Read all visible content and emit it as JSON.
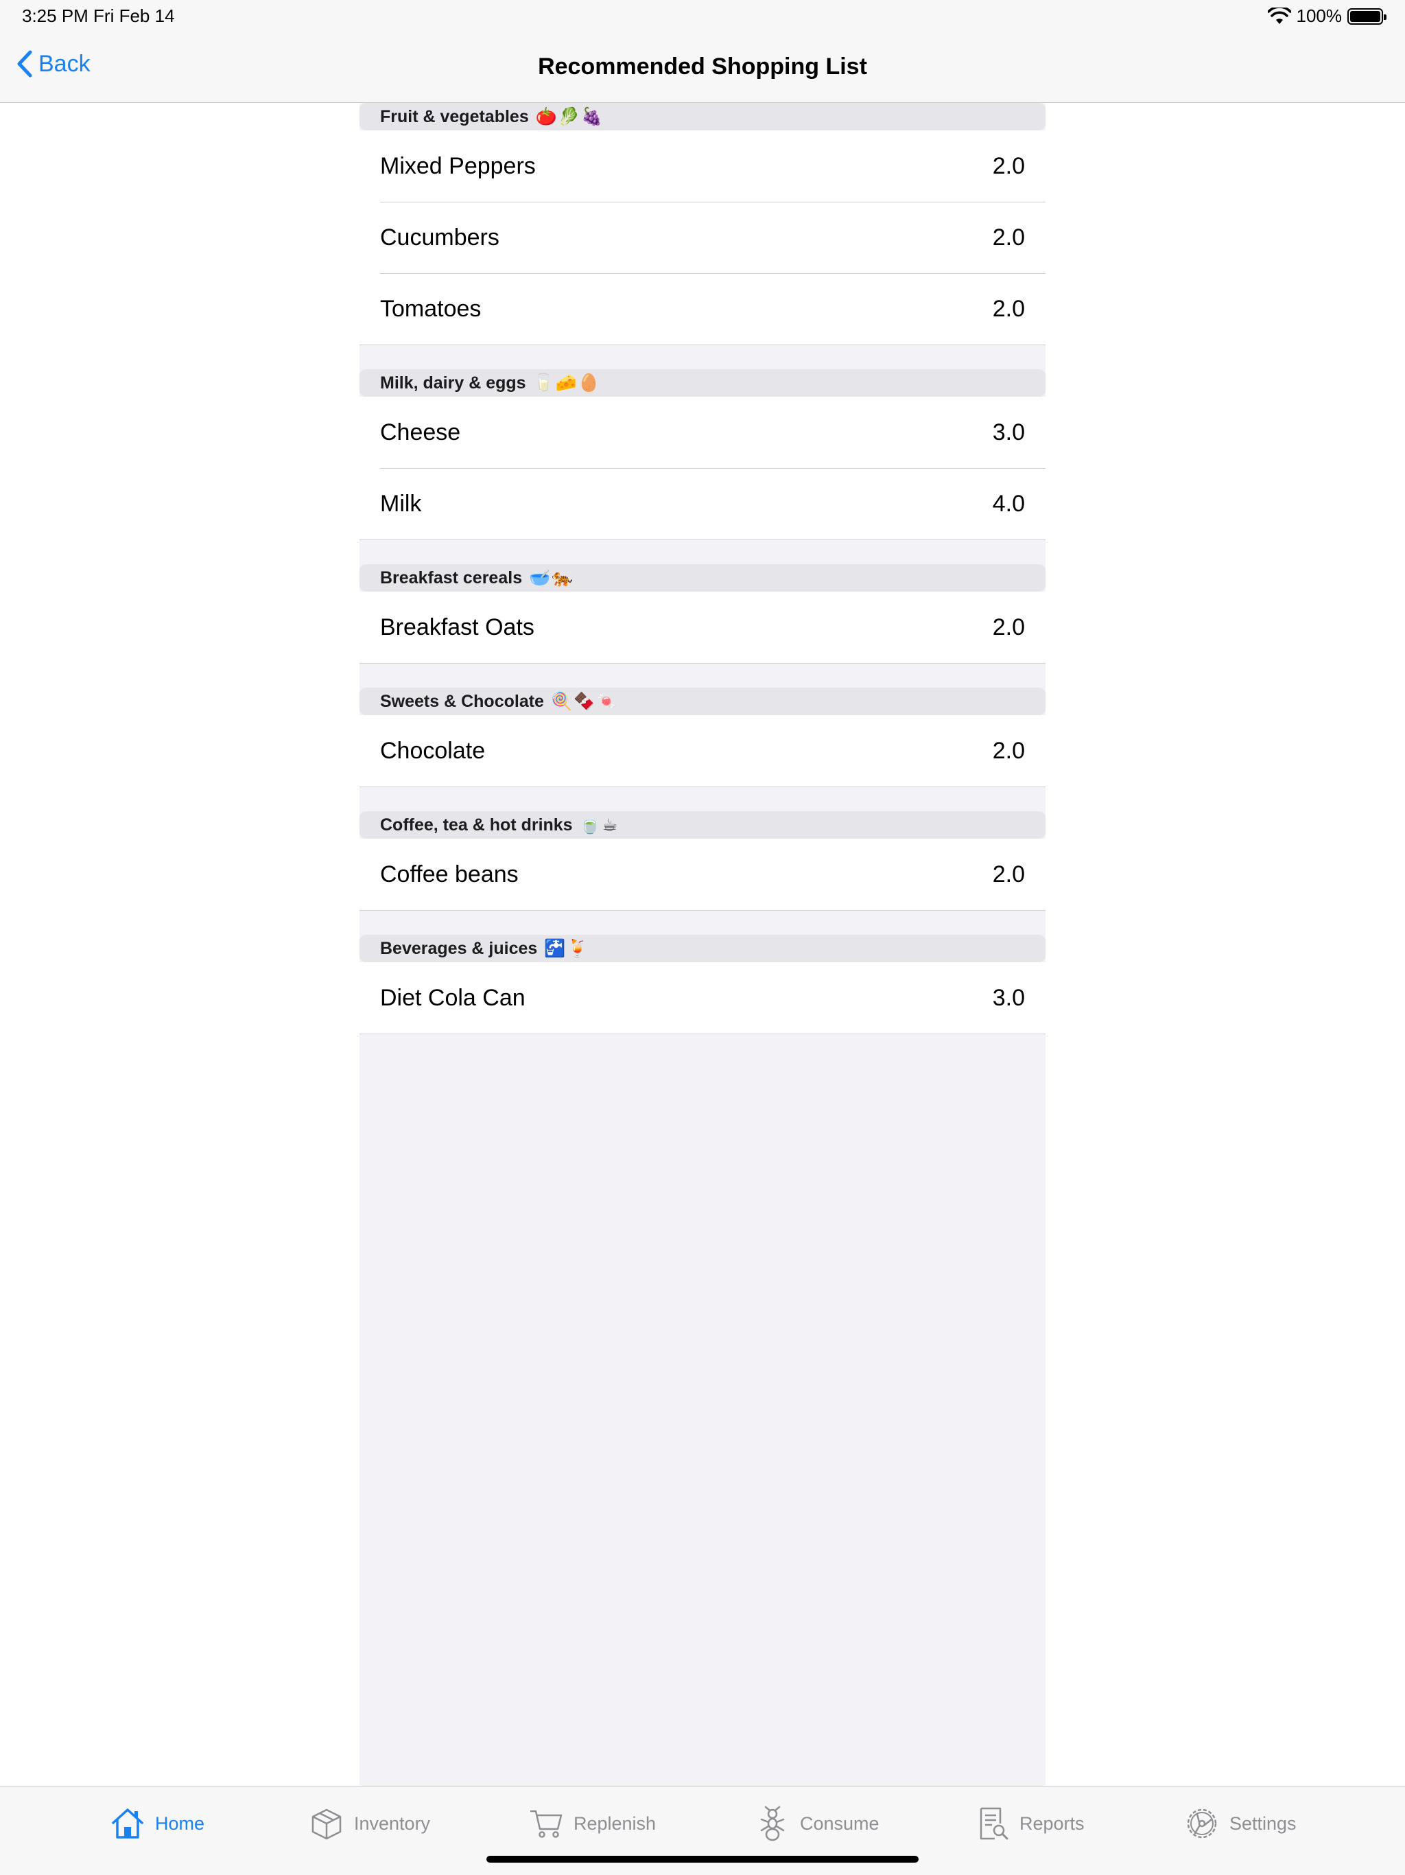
{
  "status_bar": {
    "time": "3:25 PM   Fri Feb 14",
    "battery": "100%"
  },
  "nav": {
    "back_label": "Back",
    "title": "Recommended Shopping List"
  },
  "sections": [
    {
      "header": "Fruit & vegetables",
      "emoji": "🍅🥬🍇",
      "items": [
        {
          "name": "Mixed Peppers",
          "qty": "2.0"
        },
        {
          "name": "Cucumbers",
          "qty": "2.0"
        },
        {
          "name": "Tomatoes",
          "qty": "2.0"
        }
      ]
    },
    {
      "header": "Milk, dairy & eggs",
      "emoji": "🥛🧀🥚",
      "items": [
        {
          "name": "Cheese",
          "qty": "3.0"
        },
        {
          "name": "Milk",
          "qty": "4.0"
        }
      ]
    },
    {
      "header": "Breakfast cereals",
      "emoji": "🥣🐅",
      "items": [
        {
          "name": "Breakfast Oats",
          "qty": "2.0"
        }
      ]
    },
    {
      "header": "Sweets & Chocolate",
      "emoji": "🍭🍫🍬",
      "items": [
        {
          "name": "Chocolate",
          "qty": "2.0"
        }
      ]
    },
    {
      "header": "Coffee, tea & hot drinks",
      "emoji": "🍵☕",
      "items": [
        {
          "name": "Coffee beans",
          "qty": "2.0"
        }
      ]
    },
    {
      "header": "Beverages & juices",
      "emoji": "🚰🍹",
      "items": [
        {
          "name": "Diet Cola Can",
          "qty": "3.0"
        }
      ]
    }
  ],
  "tabs": [
    {
      "label": "Home",
      "icon": "home-icon",
      "active": true
    },
    {
      "label": "Inventory",
      "icon": "box-icon",
      "active": false
    },
    {
      "label": "Replenish",
      "icon": "cart-icon",
      "active": false
    },
    {
      "label": "Consume",
      "icon": "ant-icon",
      "active": false
    },
    {
      "label": "Reports",
      "icon": "report-icon",
      "active": false
    },
    {
      "label": "Settings",
      "icon": "gear-icon",
      "active": false
    }
  ],
  "colors": {
    "accent": "#1a82f0",
    "inactive": "#8e8e93",
    "section_bg": "#e5e5ea",
    "background": "#f2f2f7"
  }
}
